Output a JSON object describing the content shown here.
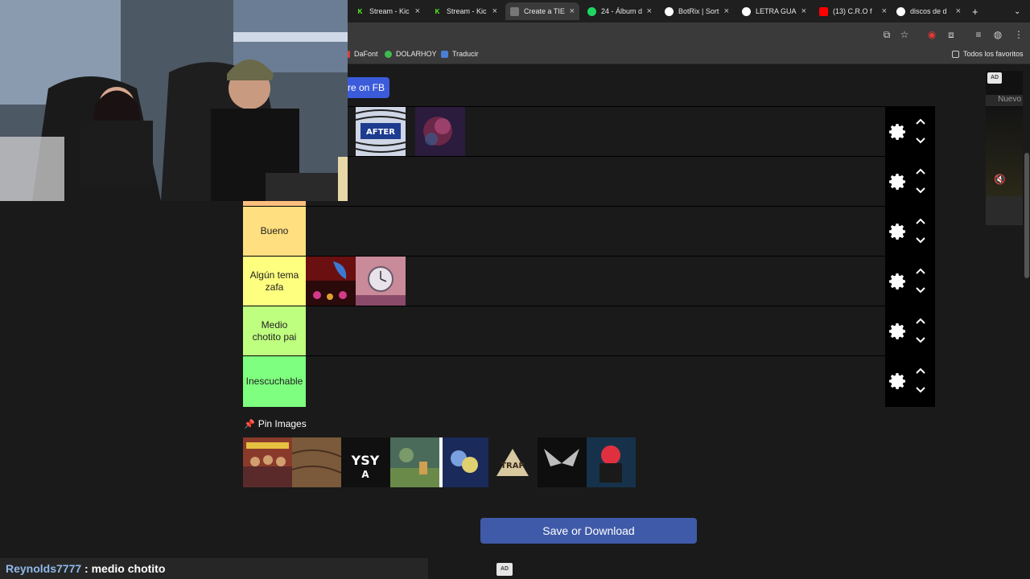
{
  "browser": {
    "tabs": [
      {
        "title": "Stream - Kic",
        "icon": "kick-icon",
        "color": "#53fc18"
      },
      {
        "title": "Stream - Kic",
        "icon": "kick-icon",
        "color": "#53fc18"
      },
      {
        "title": "Create a TIE",
        "icon": "tiermaker-icon",
        "color": "#cccccc",
        "active": true
      },
      {
        "title": "24 - Álbum d",
        "icon": "spotify-icon",
        "color": "#1ed760"
      },
      {
        "title": "BotRix | Sort",
        "icon": "botrix-icon",
        "color": "#ffffff"
      },
      {
        "title": "LETRA GUAR",
        "icon": "google-icon",
        "color": "#4285f4"
      },
      {
        "title": "(13) C.R.O f",
        "icon": "youtube-icon",
        "color": "#ff0000"
      },
      {
        "title": "discos de d",
        "icon": "google-icon",
        "color": "#4285f4"
      }
    ],
    "new_tab": "+",
    "bookmarks": [
      {
        "label": "DaFont",
        "color": "#d84040"
      },
      {
        "label": "DOLARHOY",
        "color": "#3fb950"
      },
      {
        "label": "Traducir",
        "color": "#4a7fd4"
      }
    ],
    "bookmarks_folder": "Todos los favoritos"
  },
  "page": {
    "share_label": "re on FB",
    "tiers": [
      {
        "label": "",
        "color": "#ff7f7f",
        "items": 2
      },
      {
        "label": "",
        "color": "#ffbf7f",
        "items": 0
      },
      {
        "label": "Bueno",
        "color": "#ffdf7f",
        "items": 0
      },
      {
        "label": "Algún tema zafa",
        "color": "#ffff7f",
        "items": 2
      },
      {
        "label": "Medio chotito pai",
        "color": "#bfff7f",
        "items": 0
      },
      {
        "label": "Inescuchable",
        "color": "#7fff7f",
        "items": 0
      }
    ],
    "pin_title": "Pin Images",
    "pin_count": 8,
    "save_label": "Save or Download",
    "ad_label": "AD",
    "ad_right_label": "AD",
    "ad_right_badge": "Nuevo"
  },
  "chat": {
    "user": "Reynolds7777",
    "message": " : medio chotito"
  }
}
